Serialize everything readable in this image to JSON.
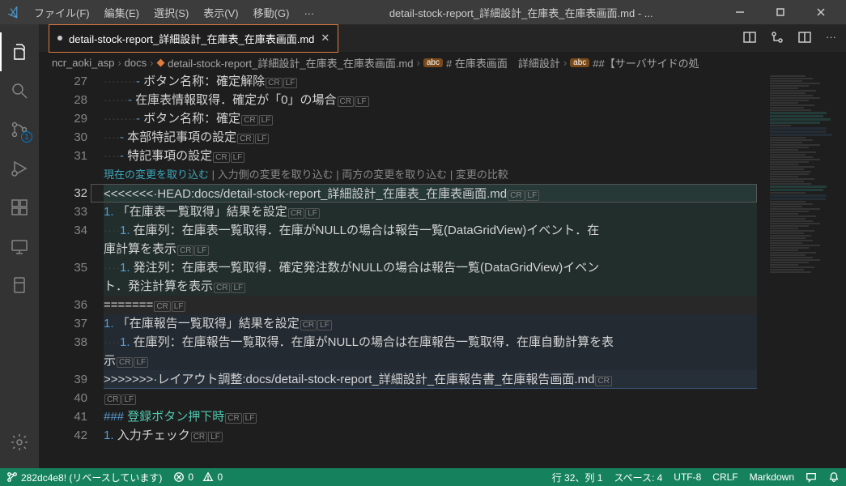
{
  "titlebar": {
    "menu": [
      "ファイル(F)",
      "編集(E)",
      "選択(S)",
      "表示(V)",
      "移動(G)",
      "…"
    ],
    "title": "detail-stock-report_詳細設計_在庫表_在庫表画面.md - ..."
  },
  "tab": {
    "filename": "detail-stock-report_詳細設計_在庫表_在庫表画面.md"
  },
  "breadcrumb": {
    "b1": "ncr_aoki_asp",
    "b2": "docs",
    "b3": "detail-stock-report_詳細設計_在庫表_在庫表画面.md",
    "b4": "# 在庫表画面　詳細設計",
    "b5": "##【サーバサイドの処"
  },
  "merge_actions": {
    "current": "現在の変更を取り込む",
    "incoming": "入力側の変更を取り込む",
    "both": "両方の変更を取り込む",
    "compare": "変更の比較"
  },
  "lines": {
    "l27": {
      "num": "27",
      "ws": "········",
      "dash": "- ",
      "text": "ボタン名称：確定解除"
    },
    "l28": {
      "num": "28",
      "ws": "······",
      "dash": "- ",
      "text": "在庫表情報取得．確定が「0」の場合"
    },
    "l29": {
      "num": "29",
      "ws": "········",
      "dash": "- ",
      "text": "ボタン名称：確定"
    },
    "l30": {
      "num": "30",
      "ws": "····",
      "dash": "- ",
      "text": "本部特記事項の設定"
    },
    "l31": {
      "num": "31",
      "ws": "····",
      "dash": "- ",
      "text": "特記事項の設定"
    },
    "l32": {
      "num": "32",
      "text": "<<<<<<<·HEAD:docs/detail-stock-report_詳細設計_在庫表_在庫表画面.md"
    },
    "l33": {
      "num": "33",
      "ord": "1. ",
      "text": "「在庫表一覧取得」結果を設定"
    },
    "l34": {
      "num": "34",
      "ws": "····",
      "ord": "1. ",
      "text": "在庫列：在庫表一覧取得．在庫がNULLの場合は報告一覧(DataGridView)イベント．在庫計算を表示"
    },
    "l35": {
      "num": "35",
      "ws": "····",
      "ord": "1. ",
      "text": "発注列：在庫表一覧取得．確定発注数がNULLの場合は報告一覧(DataGridView)イベント．発注計算を表示"
    },
    "l36": {
      "num": "36",
      "text": "======="
    },
    "l37": {
      "num": "37",
      "ord": "1. ",
      "text": "「在庫報告一覧取得」結果を設定"
    },
    "l38": {
      "num": "38",
      "ws": "····",
      "ord": "1. ",
      "text": "在庫列：在庫報告一覧取得．在庫がNULLの場合は在庫報告一覧取得．在庫自動計算を表示"
    },
    "l39": {
      "num": "39",
      "text": ">>>>>>>·レイアウト調整:docs/detail-stock-report_詳細設計_在庫報告書_在庫報告画面.md"
    },
    "l40": {
      "num": "40"
    },
    "l41": {
      "num": "41",
      "hash": "### ",
      "text": "登録ボタン押下時"
    },
    "l42": {
      "num": "42",
      "ord": "1. ",
      "text": "入力チェック"
    }
  },
  "status": {
    "branch": "282dc4e8! (リベースしています)",
    "errors": "0",
    "warnings": "0",
    "line_col": "行 32、列 1",
    "spaces": "スペース: 4",
    "encoding": "UTF-8",
    "eol": "CRLF",
    "lang": "Markdown"
  },
  "activity_badges": {
    "scm": "1"
  }
}
